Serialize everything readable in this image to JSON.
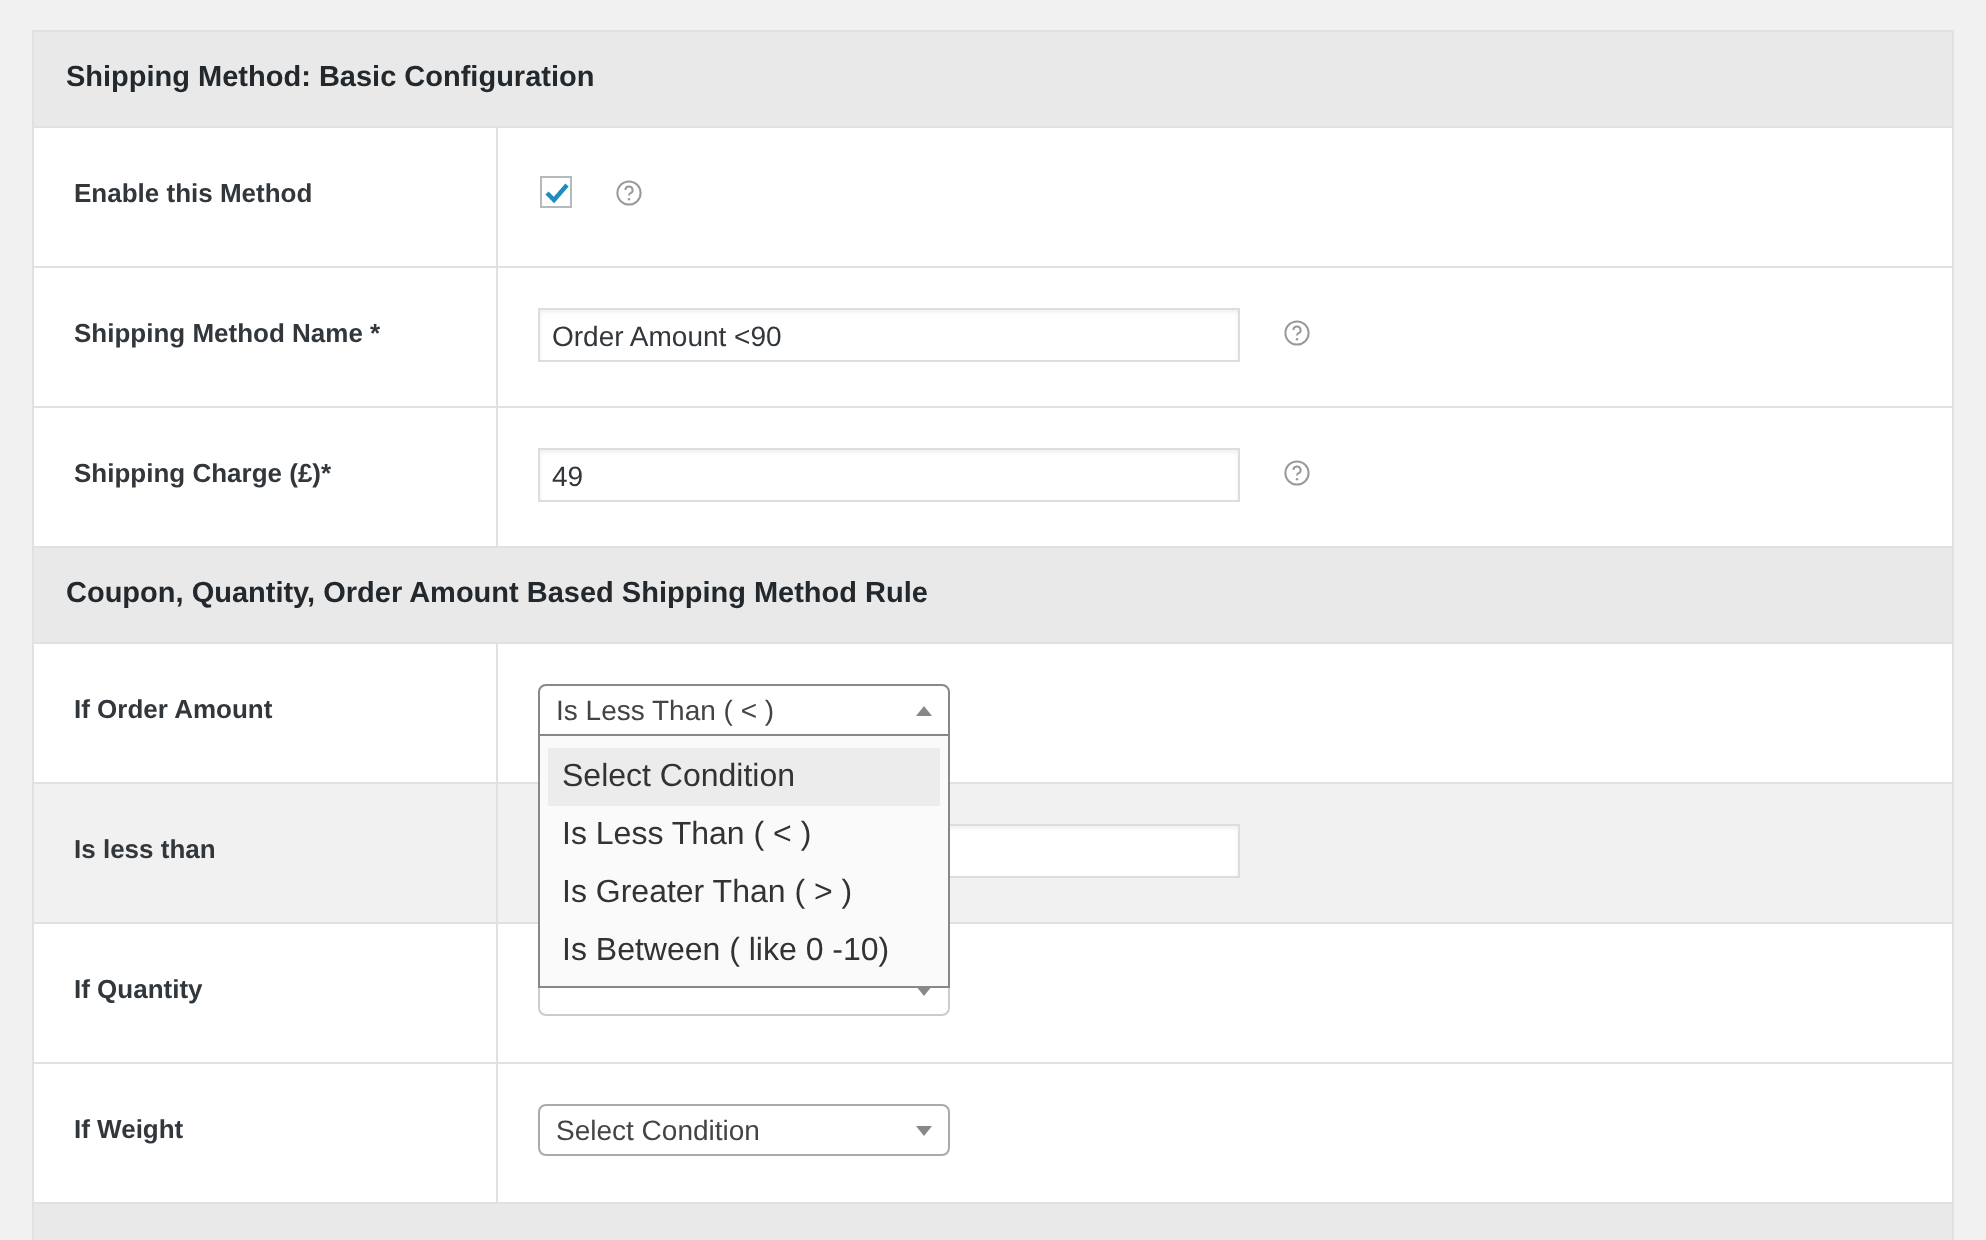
{
  "sections": [
    {
      "title": "Shipping Method: Basic Configuration",
      "rows": [
        {
          "kind": "checkbox",
          "label": "Enable this Method",
          "checked": true,
          "help": true,
          "shaded": false
        },
        {
          "kind": "text",
          "label": "Shipping Method Name *",
          "value": "Order Amount <90",
          "help": true,
          "shaded": false
        },
        {
          "kind": "text",
          "label": "Shipping Charge (£)*",
          "value": "49",
          "help": true,
          "shaded": false
        }
      ]
    },
    {
      "title": "Coupon, Quantity, Order Amount Based Shipping Method Rule",
      "rows": [
        {
          "kind": "select",
          "label": "If Order Amount",
          "value": "Is Less Than ( < )",
          "open": true,
          "shaded": false,
          "options": [
            {
              "label": "Select Condition",
              "highlighted": true
            },
            {
              "label": "Is Less Than ( < )",
              "highlighted": false
            },
            {
              "label": "Is Greater Than ( > )",
              "highlighted": false
            },
            {
              "label": "Is Between ( like 0 -10)",
              "highlighted": false
            }
          ]
        },
        {
          "kind": "text",
          "label": "Is less than",
          "shaded": true,
          "help": false
        },
        {
          "kind": "select",
          "label": "If Quantity",
          "open": false,
          "shaded": false
        },
        {
          "kind": "select",
          "label": "If Weight",
          "value": "Select Condition",
          "open": false,
          "shaded": false
        }
      ]
    }
  ],
  "more_below": true
}
